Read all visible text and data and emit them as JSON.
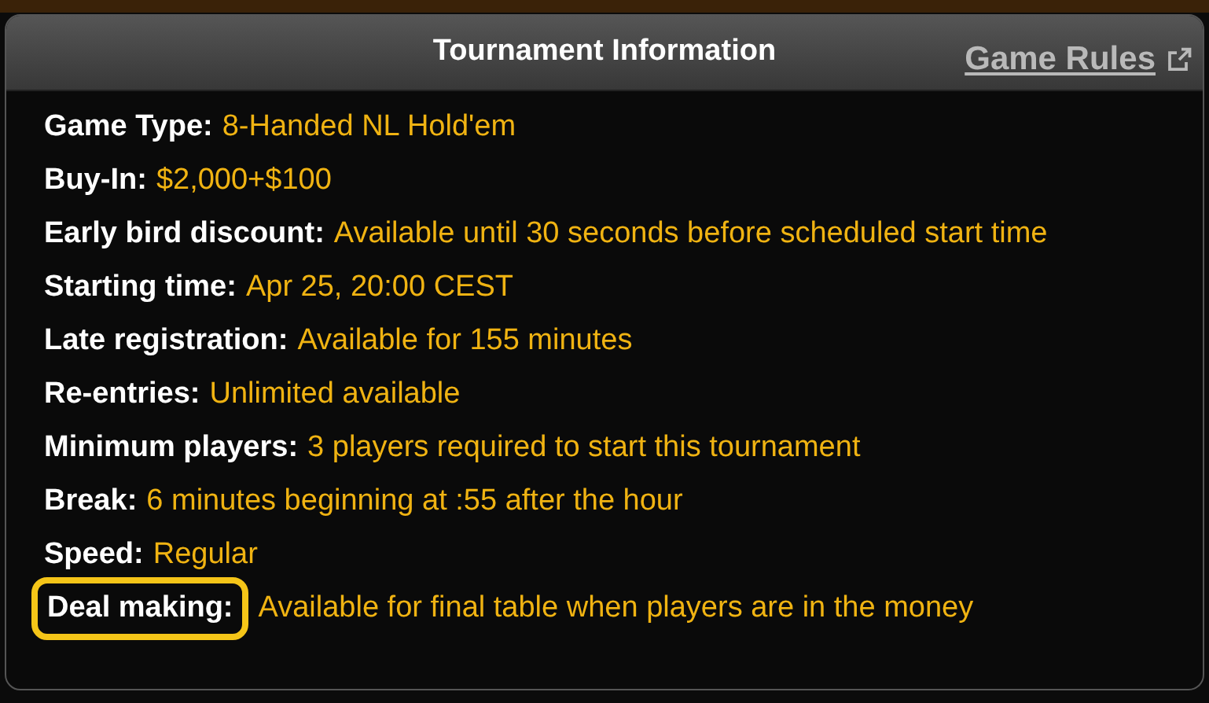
{
  "panel": {
    "title": "Tournament Information",
    "link": "Game Rules"
  },
  "rows": [
    {
      "label": "Game Type:",
      "value": "8-Handed NL Hold'em",
      "highlighted": false
    },
    {
      "label": "Buy-In:",
      "value": "$2,000+$100",
      "highlighted": false
    },
    {
      "label": "Early bird discount:",
      "value": "Available until 30 seconds before scheduled start time",
      "highlighted": false
    },
    {
      "label": "Starting time:",
      "value": "Apr 25, 20:00 CEST",
      "highlighted": false
    },
    {
      "label": "Late registration:",
      "value": "Available for 155 minutes",
      "highlighted": false
    },
    {
      "label": "Re-entries:",
      "value": "Unlimited available",
      "highlighted": false
    },
    {
      "label": "Minimum players:",
      "value": "3 players required to start this tournament",
      "highlighted": false
    },
    {
      "label": "Break:",
      "value": "6 minutes beginning at :55 after the hour",
      "highlighted": false
    },
    {
      "label": "Speed:",
      "value": "Regular",
      "highlighted": false
    },
    {
      "label": "Deal making:",
      "value": "Available for final table when players are in the money",
      "highlighted": true
    }
  ]
}
